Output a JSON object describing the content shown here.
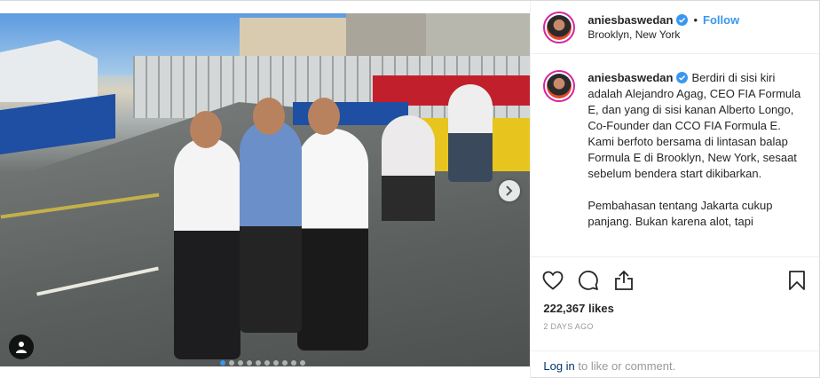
{
  "header": {
    "username": "aniesbaswedan",
    "bullet": "•",
    "follow_label": "Follow",
    "location": "Brooklyn, New York"
  },
  "caption": {
    "username": "aniesbaswedan",
    "text": "Berdiri di sisi kiri adalah Alejandro Agag, CEO FIA Formula E, dan yang di sisi kanan Alberto Longo, Co-Founder dan CCO FIA Formula E. Kami berfoto bersama di lintasan balap Formula E di Brooklyn, New York, sesaat sebelum bendera start dikibarkan.\n\nPembahasan tentang Jakarta cukup panjang. Bukan karena alot, tapi"
  },
  "actions": {
    "like_icon": "heart-icon",
    "comment_icon": "comment-icon",
    "share_icon": "share-icon",
    "save_icon": "bookmark-icon"
  },
  "likes": "222,367 likes",
  "posted": "2 DAYS AGO",
  "login": {
    "link_label": "Log in",
    "rest": " to like or comment."
  },
  "carousel": {
    "slide_count": 10,
    "active_index": 0
  },
  "colors": {
    "accent": "#3897f0",
    "text": "#262626",
    "muted": "#999999",
    "border": "#efefef"
  }
}
